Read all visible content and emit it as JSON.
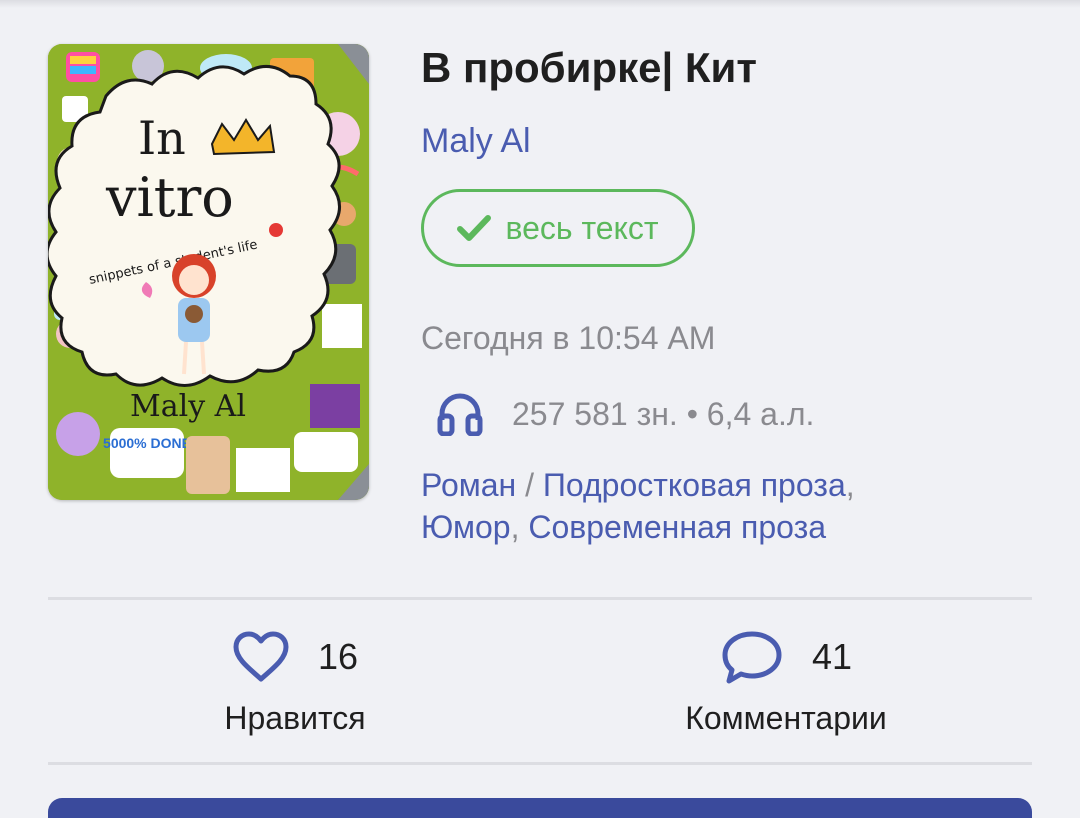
{
  "book": {
    "title": "В пробирке| Кит",
    "author": "Maly Al",
    "status_label": "весь текст",
    "date": "Сегодня в 10:54 AM",
    "stats": "257 581 зн. • 6,4 а.л.",
    "genre_main": "Роман",
    "genre_sep": "/",
    "genres": [
      "Подростковая проза",
      "Юмор",
      "Современная проза"
    ]
  },
  "cover": {
    "title_line1": "In",
    "title_line2": "vitro",
    "subtitle": "snippets of a student's life",
    "author": "Maly Al",
    "sticker_done": "5000% DONE",
    "colors": {
      "background": "#8fb32a",
      "paper": "#fbf8ee"
    }
  },
  "actions": {
    "likes": {
      "count": "16",
      "label": "Нравится",
      "icon": "heart-icon"
    },
    "comments": {
      "count": "41",
      "label": "Комментарии",
      "icon": "comment-icon"
    }
  },
  "colors": {
    "accent": "#4a5cb0",
    "success": "#5cb85c",
    "muted": "#8a8a8f",
    "text": "#1f1f1f"
  }
}
